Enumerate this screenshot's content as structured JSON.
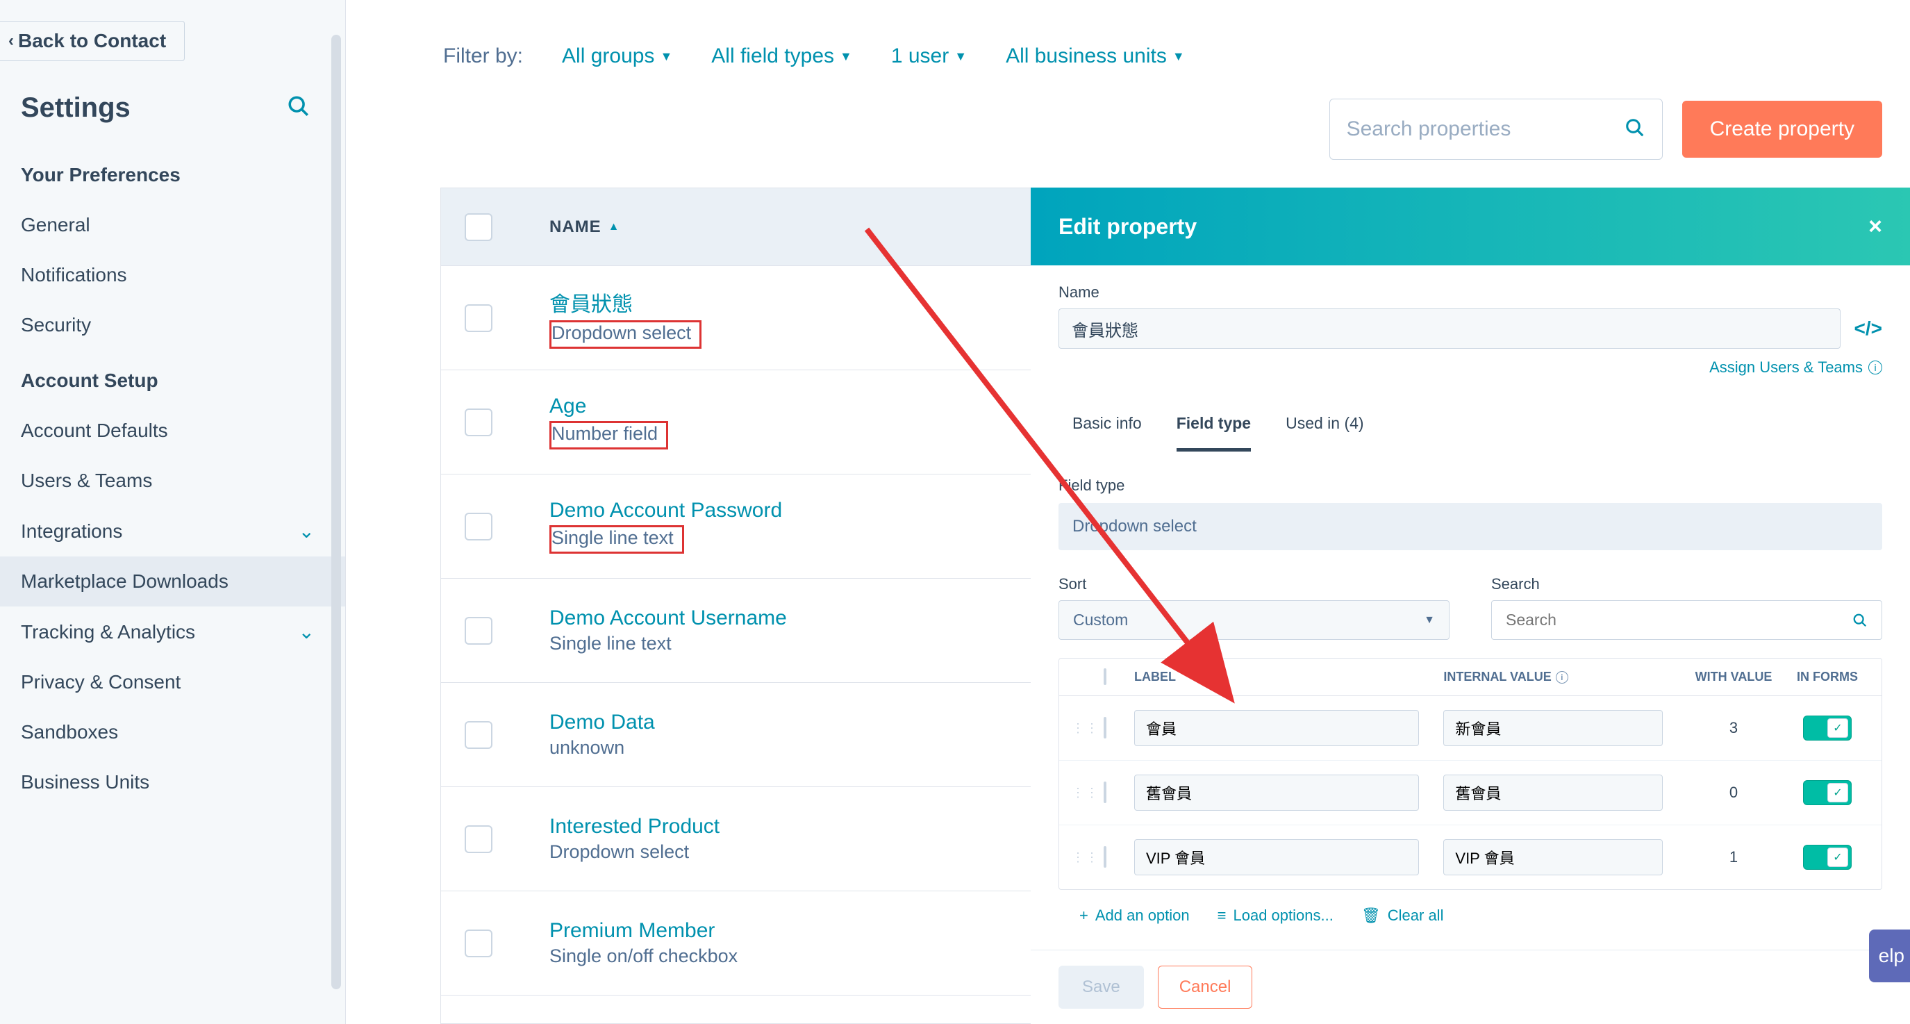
{
  "sidebar": {
    "back": "Back to Contact",
    "settings_title": "Settings",
    "preferences_title": "Your Preferences",
    "preferences": [
      {
        "label": "General"
      },
      {
        "label": "Notifications"
      },
      {
        "label": "Security"
      }
    ],
    "account_title": "Account Setup",
    "account": [
      {
        "label": "Account Defaults",
        "chev": false
      },
      {
        "label": "Users & Teams",
        "chev": false
      },
      {
        "label": "Integrations",
        "chev": true
      },
      {
        "label": "Marketplace Downloads",
        "chev": false,
        "active": true
      },
      {
        "label": "Tracking & Analytics",
        "chev": true
      },
      {
        "label": "Privacy & Consent",
        "chev": false
      },
      {
        "label": "Sandboxes",
        "chev": false
      },
      {
        "label": "Business Units",
        "chev": false
      }
    ]
  },
  "filters": {
    "label": "Filter by:",
    "items": [
      "All groups",
      "All field types",
      "1 user",
      "All business units"
    ]
  },
  "search_placeholder": "Search properties",
  "create_btn": "Create property",
  "table": {
    "name_header": "NAME",
    "rows": [
      {
        "name": "會員狀態",
        "type": "Dropdown select",
        "boxed": true
      },
      {
        "name": "Age",
        "type": "Number field",
        "boxed": true
      },
      {
        "name": "Demo Account Password",
        "type": "Single line text",
        "boxed": true
      },
      {
        "name": "Demo Account Username",
        "type": "Single line text",
        "boxed": false
      },
      {
        "name": "Demo Data",
        "type": "unknown",
        "boxed": false
      },
      {
        "name": "Interested Product",
        "type": "Dropdown select",
        "boxed": false
      },
      {
        "name": "Premium Member",
        "type": "Single on/off checkbox",
        "boxed": false
      }
    ]
  },
  "panel": {
    "title": "Edit property",
    "name_label": "Name",
    "name_value": "會員狀態",
    "assign_link": "Assign Users & Teams",
    "tabs": [
      "Basic info",
      "Field type",
      "Used in (4)"
    ],
    "active_tab": 1,
    "field_type_label": "Field type",
    "field_type_value": "Dropdown select",
    "sort_label": "Sort",
    "sort_value": "Custom",
    "search_label": "Search",
    "search_placeholder": "Search",
    "opt_headers": {
      "label": "LABEL",
      "internal": "INTERNAL VALUE",
      "with": "WITH VALUE",
      "forms": "IN FORMS"
    },
    "options": [
      {
        "label": "會員",
        "internal": "新會員",
        "with": "3"
      },
      {
        "label": "舊會員",
        "internal": "舊會員",
        "with": "0"
      },
      {
        "label": "VIP 會員",
        "internal": "VIP 會員",
        "with": "1"
      }
    ],
    "actions": {
      "add": "Add an option",
      "load": "Load options...",
      "clear": "Clear all"
    },
    "save": "Save",
    "cancel": "Cancel"
  },
  "help": "elp"
}
